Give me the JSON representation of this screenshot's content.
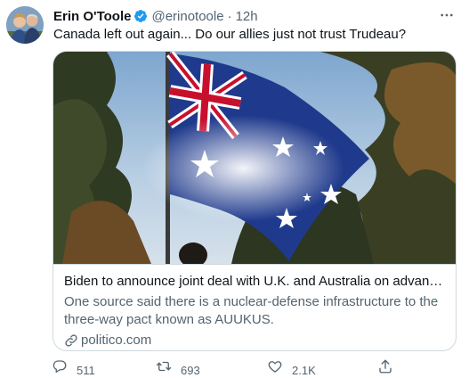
{
  "tweet": {
    "author_name": "Erin O'Toole",
    "handle": "@erinotoole",
    "separator": "·",
    "time": "12h",
    "text": "Canada left out again... Do our allies just not trust Trudeau?"
  },
  "card": {
    "title": "Biden to announce joint deal with U.K. and Australia on advanced def...",
    "description": "One source said there is a nuclear-defense infrastructure to the three-way pact known as AUUKUS.",
    "domain": "politico.com"
  },
  "actions": {
    "reply_count": "511",
    "retweet_count": "693",
    "like_count": "2.1K"
  },
  "icons": {
    "verified": "verified-badge-icon",
    "more": "more-options-icon",
    "link": "link-icon",
    "reply": "reply-icon",
    "retweet": "retweet-icon",
    "like": "heart-icon",
    "share": "share-icon"
  },
  "colors": {
    "accent": "#1d9bf0",
    "secondary_text": "#536471",
    "border": "#cfd9de"
  }
}
